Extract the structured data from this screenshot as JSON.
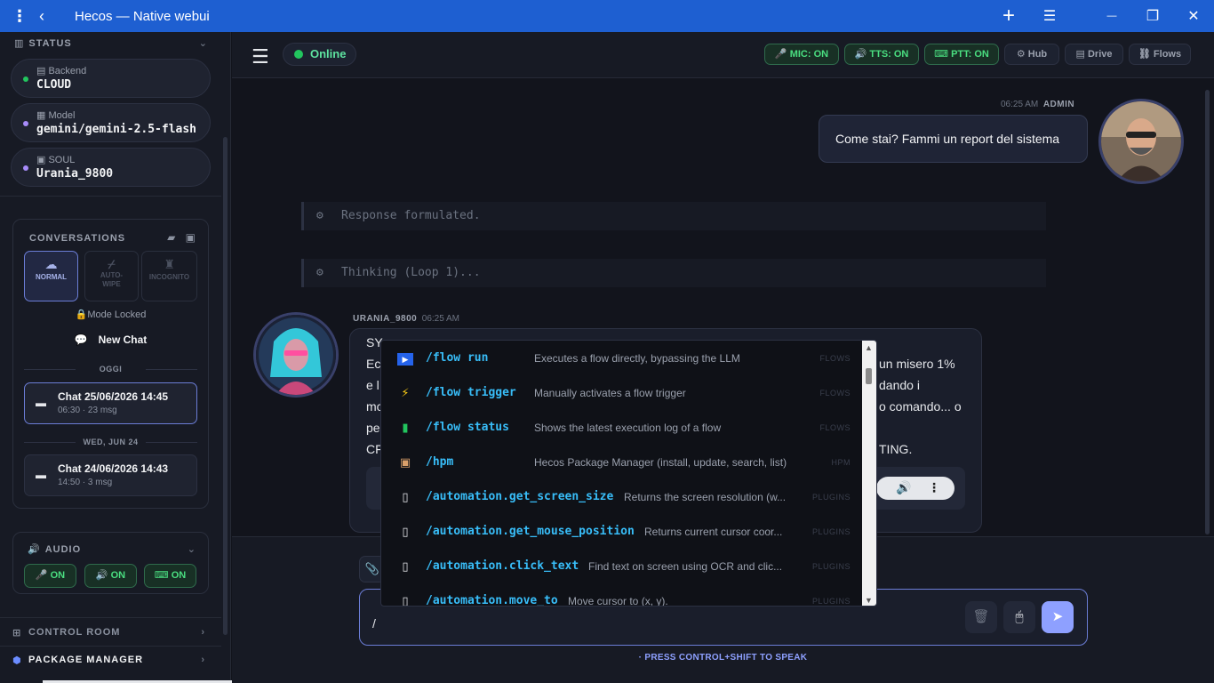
{
  "window": {
    "title": "Hecos — Native webui",
    "menu_icon": "⋮",
    "back_icon": "‹",
    "add_icon": "+",
    "list_icon": "☰",
    "min_icon": "—",
    "restore_icon": "❐",
    "close_icon": "✕"
  },
  "sidebar": {
    "status": {
      "title": "STATUS",
      "backend": {
        "label": "Backend",
        "value": "CLOUD",
        "dot_color": "#22c55e"
      },
      "model": {
        "label": "Model",
        "value": "gemini/gemini-2.5-flash",
        "dot_color": "#a78bfa"
      },
      "soul": {
        "label": "SOUL",
        "value": "Urania_9800",
        "dot_color": "#a78bfa"
      }
    },
    "conversations": {
      "title": "CONVERSATIONS",
      "modes": [
        {
          "label": "NORMAL",
          "icon": "cloud-icon",
          "active": true
        },
        {
          "label": "AUTO-WIPE",
          "icon": "broom-icon",
          "active": false
        },
        {
          "label": "INCOGNITO",
          "icon": "incognito-icon",
          "active": false
        }
      ],
      "mode_locked": "Mode Locked",
      "new_chat": "New Chat",
      "groups": [
        {
          "label": "OGGI",
          "items": [
            {
              "title": "Chat 25/06/2026 14:45",
              "meta": "06:30 · 23 msg",
              "active": true
            }
          ]
        },
        {
          "label": "WED, JUN 24",
          "items": [
            {
              "title": "Chat 24/06/2026 14:43",
              "meta": "14:50 · 3 msg",
              "active": false
            }
          ]
        }
      ]
    },
    "audio": {
      "title": "AUDIO",
      "buttons": [
        {
          "icon": "microphone-icon",
          "label": "ON"
        },
        {
          "icon": "speaker-icon",
          "label": "ON"
        },
        {
          "icon": "keyboard-icon",
          "label": "ON"
        }
      ]
    },
    "nav": [
      {
        "label": "CONTROL ROOM",
        "icon": "grid-icon",
        "color": "#8b92a0"
      },
      {
        "label": "PACKAGE MANAGER",
        "icon": "cube-icon",
        "color": "#f3f4f6"
      }
    ]
  },
  "topbar": {
    "status": "Online",
    "buttons": [
      {
        "label": "MIC: ON",
        "icon": "🎤",
        "kind": "green"
      },
      {
        "label": "TTS: ON",
        "icon": "🔊",
        "kind": "green"
      },
      {
        "label": "PTT: ON",
        "icon": "⌨",
        "kind": "green"
      },
      {
        "label": "Hub",
        "icon": "⚙",
        "kind": "neutral"
      },
      {
        "label": "Drive",
        "icon": "▤",
        "kind": "neutral"
      },
      {
        "label": "Flows",
        "icon": "⛓",
        "kind": "neutral"
      }
    ]
  },
  "chat": {
    "user_message": {
      "time": "06:25 AM",
      "author": "ADMIN",
      "text": "Come stai? Fammi un report del sistema"
    },
    "logs": [
      "Response formulated.",
      "Thinking (Loop 1)..."
    ],
    "bot_message": {
      "author": "URANIA_9800",
      "time": "06:25 AM",
      "lines_left": [
        "SY",
        "Ec",
        "e l",
        "mc",
        "pe",
        "CF"
      ],
      "lines_right": [
        "un misero 1%",
        "dando i",
        "o comando... o",
        "",
        "TING."
      ]
    }
  },
  "composer": {
    "input_value": "/",
    "hint": "· PRESS CONTROL+SHIFT TO SPEAK"
  },
  "command_menu": [
    {
      "command": "/flow run",
      "description": "Executes a flow directly, bypassing the LLM",
      "group": "FLOWS",
      "icon": "▶"
    },
    {
      "command": "/flow trigger",
      "description": "Manually activates a flow trigger",
      "group": "FLOWS",
      "icon": "⚡"
    },
    {
      "command": "/flow status",
      "description": "Shows the latest execution log of a flow",
      "group": "FLOWS",
      "icon": "▮"
    },
    {
      "command": "/hpm",
      "description": "Hecos Package Manager (install, update, search, list)",
      "group": "HPM",
      "icon": "▣"
    },
    {
      "command": "/automation.get_screen_size",
      "description": "Returns the screen resolution (w...",
      "group": "PLUGINS",
      "icon": "▯"
    },
    {
      "command": "/automation.get_mouse_position",
      "description": "Returns current cursor coor...",
      "group": "PLUGINS",
      "icon": "▯"
    },
    {
      "command": "/automation.click_text",
      "description": "Find text on screen using OCR and clic...",
      "group": "PLUGINS",
      "icon": "▯"
    },
    {
      "command": "/automation.move_to",
      "description": "Move cursor to (x, y).",
      "group": "PLUGINS",
      "icon": "▯"
    }
  ]
}
